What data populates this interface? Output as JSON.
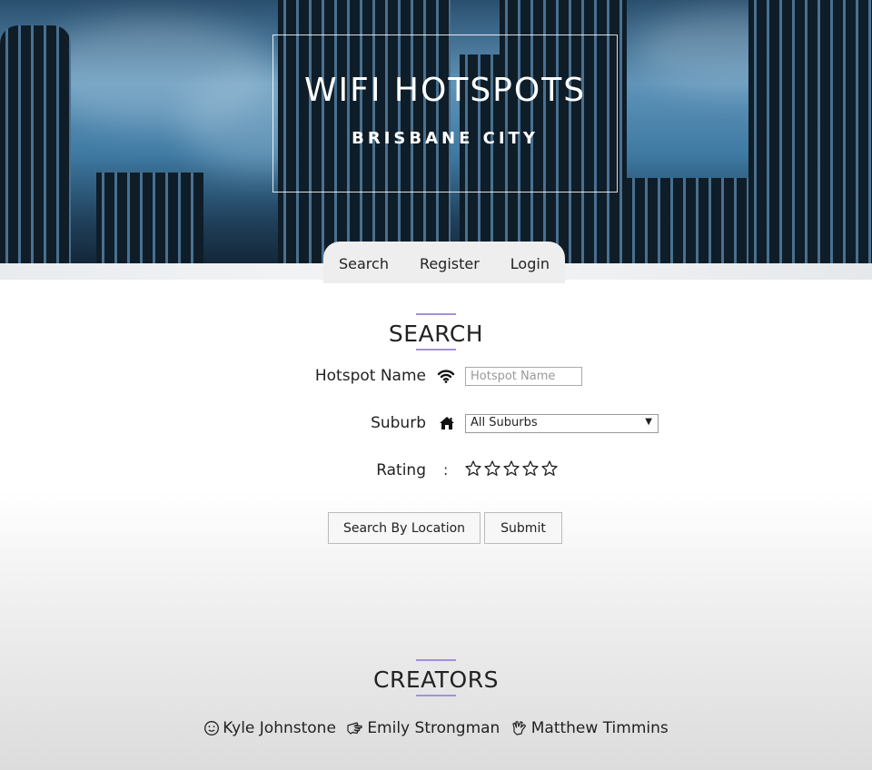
{
  "hero": {
    "title": "WIFI HOTSPOTS",
    "subtitle": "BRISBANE CITY"
  },
  "nav": {
    "items": [
      "Search",
      "Register",
      "Login"
    ]
  },
  "search": {
    "heading": "SEARCH",
    "hotspot_name": {
      "label": "Hotspot Name",
      "icon": "wifi-icon",
      "placeholder": "Hotspot Name",
      "value": ""
    },
    "suburb": {
      "label": "Suburb",
      "icon": "home-icon",
      "selected": "All Suburbs"
    },
    "rating": {
      "label": "Rating",
      "separator": ":",
      "max_stars": 5,
      "value": 0
    },
    "buttons": {
      "location": "Search By Location",
      "submit": "Submit"
    }
  },
  "creators": {
    "heading": "CREATORS",
    "people": [
      {
        "name": "Kyle Johnstone",
        "icon": "smiley-icon"
      },
      {
        "name": "Emily Strongman",
        "icon": "pointing-hand-icon"
      },
      {
        "name": "Matthew Timmins",
        "icon": "spock-hand-icon"
      }
    ]
  },
  "colors": {
    "accent_bar": "#a48ee0",
    "nav_bg": "#eeeeee"
  }
}
